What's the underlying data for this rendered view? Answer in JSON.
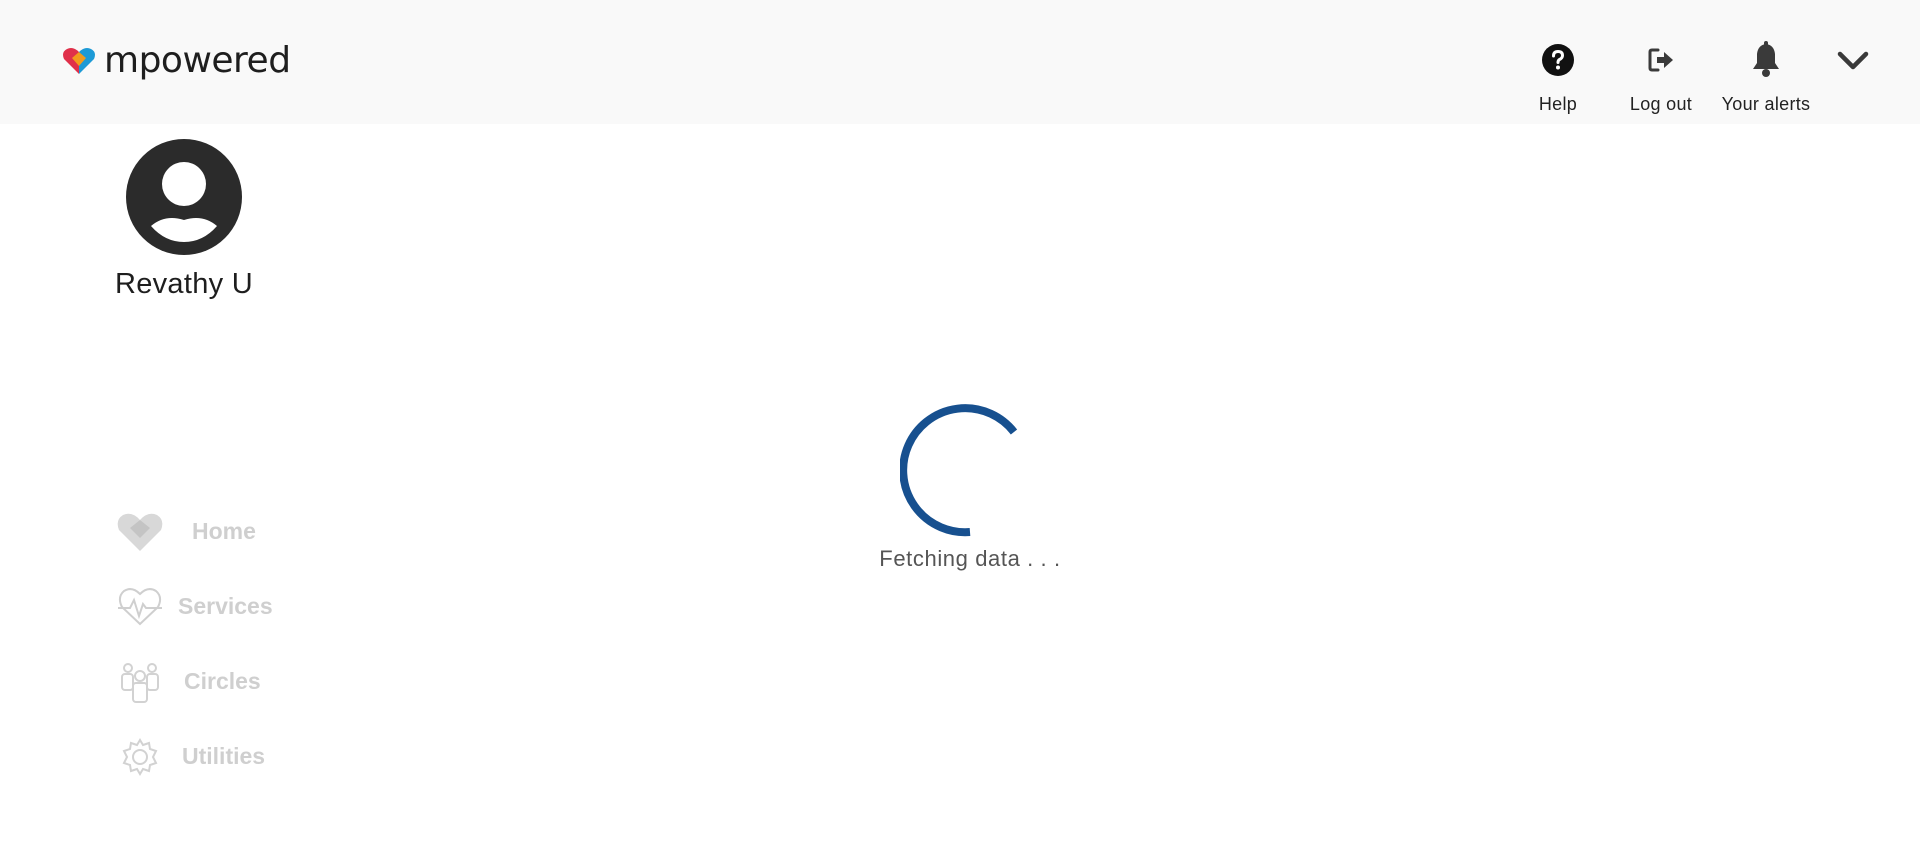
{
  "header": {
    "logo_text": "mpowered",
    "help_label": "Help",
    "logout_label": "Log out",
    "alerts_label": "Your alerts",
    "menu_icon": "chevron-down-icon"
  },
  "profile": {
    "name": "Revathy U",
    "avatar_icon": "user-avatar-icon"
  },
  "nav": {
    "items": [
      {
        "label": "Home",
        "icon": "heart-home-icon"
      },
      {
        "label": "Services",
        "icon": "heartbeat-icon"
      },
      {
        "label": "Circles",
        "icon": "people-icon"
      },
      {
        "label": "Utilities",
        "icon": "gear-icon"
      }
    ]
  },
  "main": {
    "loading_text": "Fetching data . . .",
    "spinner_color": "#17508f"
  },
  "colors": {
    "header_bg": "#f9f9f9",
    "nav_disabled": "#cfcfcf",
    "logo_red": "#e0304a",
    "logo_blue": "#1d9ad6",
    "logo_orange": "#f29a1d"
  }
}
